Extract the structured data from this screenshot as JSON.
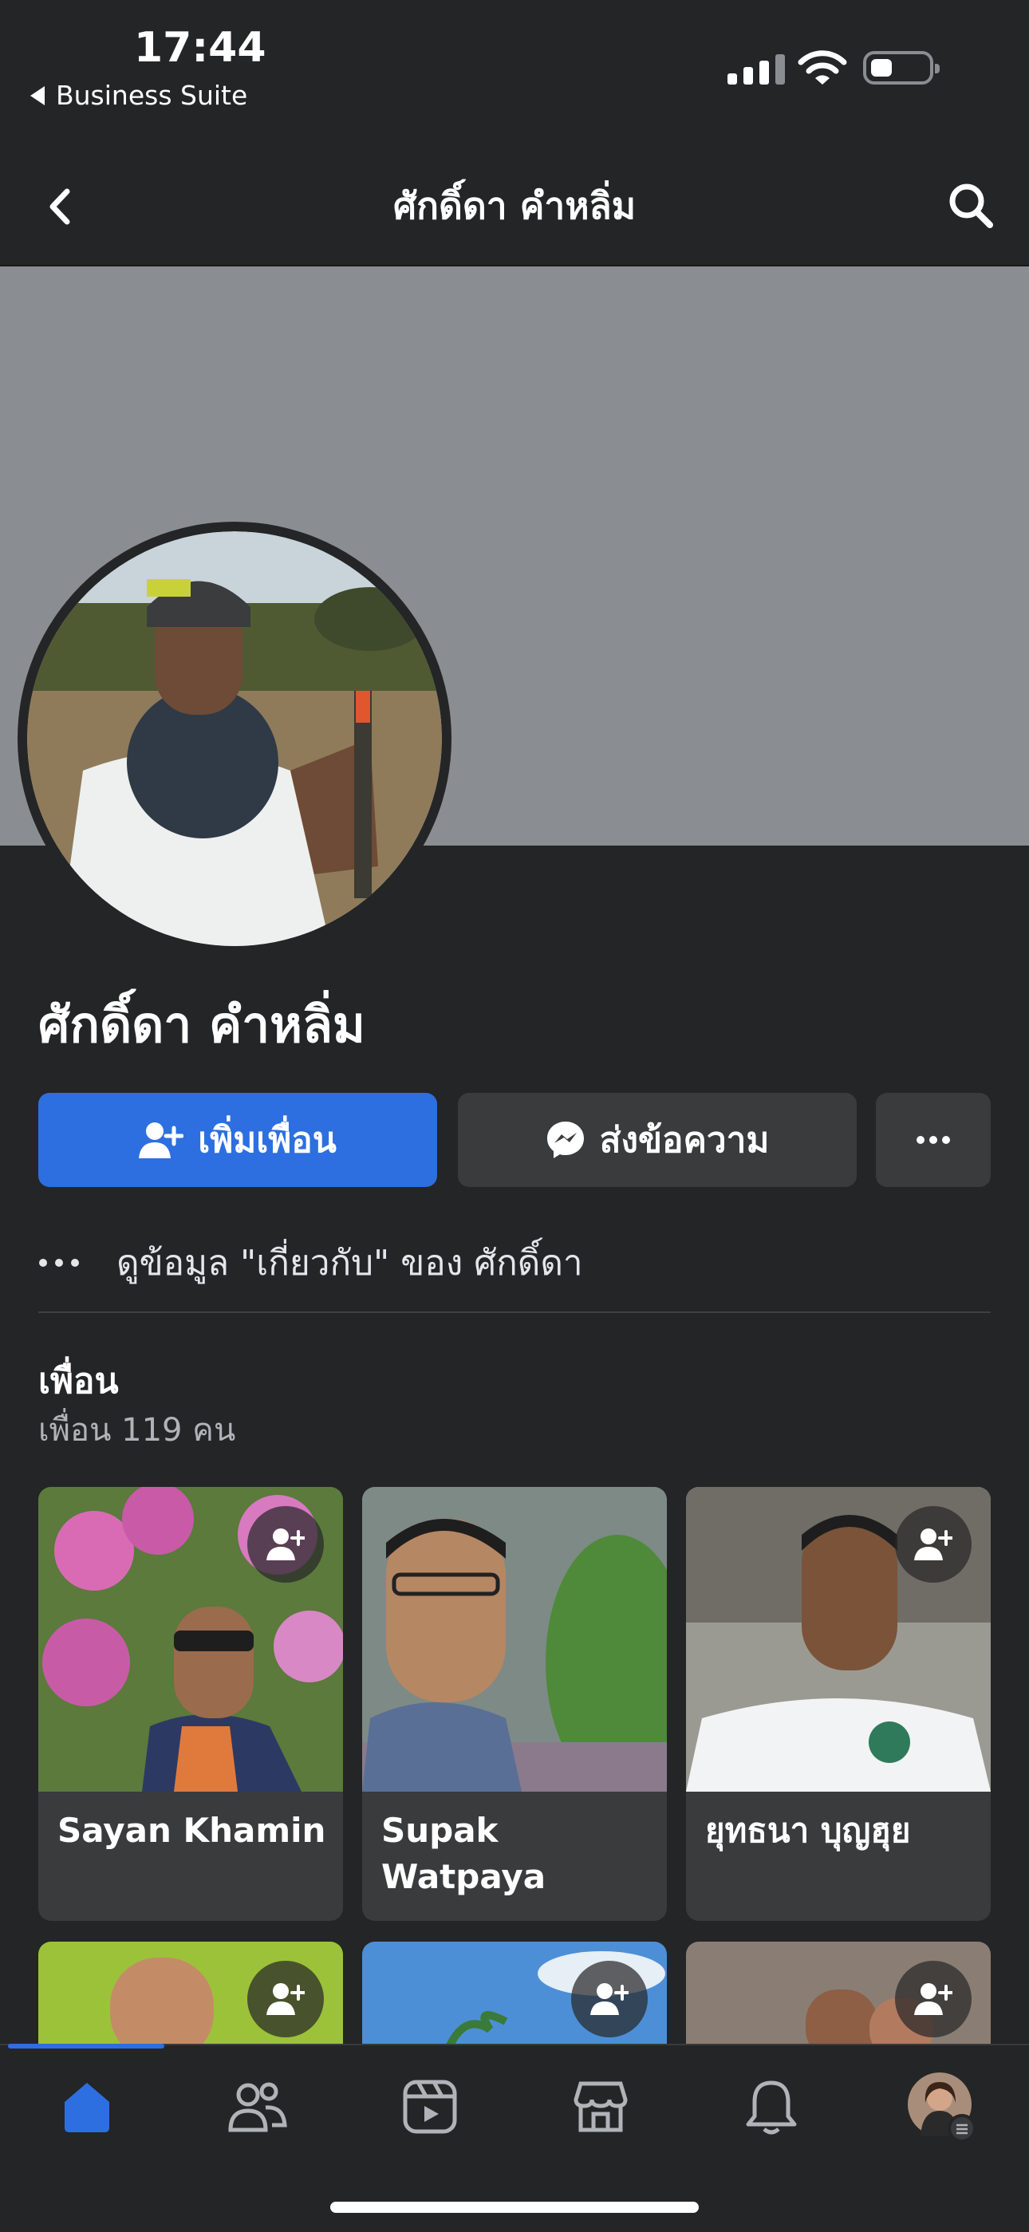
{
  "status_bar": {
    "time": "17:44",
    "back_app": "Business Suite"
  },
  "header": {
    "title": "ศักดิ์ดา คำหลิ่ม"
  },
  "profile": {
    "name": "ศักดิ์ดา คำหลิ่ม"
  },
  "actions": {
    "add_friend": "เพิ่มเพื่อน",
    "message": "ส่งข้อความ"
  },
  "about": {
    "label": "ดูข้อมูล \"เกี่ยวกับ\" ของ ศักดิ์ดา"
  },
  "friends": {
    "title": "เพื่อน",
    "count": "เพื่อน 119 คน",
    "items": [
      {
        "name": "Sayan Khamin"
      },
      {
        "name": "Supak Watpaya"
      },
      {
        "name": "ยุทธนา บุญฮุย"
      }
    ]
  },
  "colors": {
    "accent": "#2d6fe0",
    "background": "#242526",
    "card": "#3a3b3c"
  },
  "tabs": [
    "home-icon",
    "friends-icon",
    "video-icon",
    "marketplace-icon",
    "bell-icon",
    "profile-avatar"
  ]
}
